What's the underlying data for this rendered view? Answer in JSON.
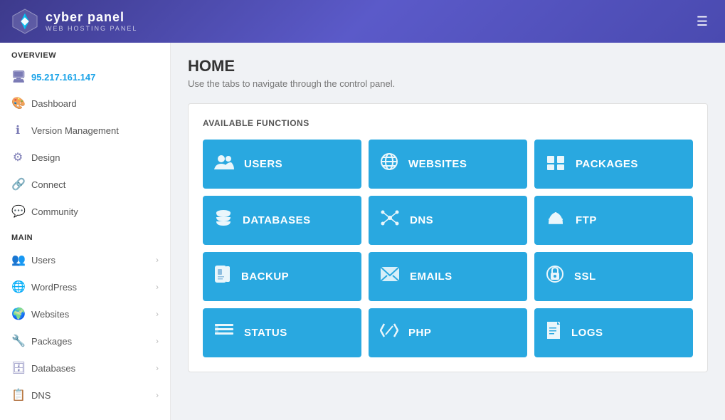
{
  "header": {
    "logo_title": "cyber panel",
    "logo_subtitle": "WEB HOSTING PANEL",
    "toggle_icon": "☰"
  },
  "sidebar": {
    "overview_label": "OVERVIEW",
    "main_label": "MAIN",
    "ip_address": "95.217.161.147",
    "overview_items": [
      {
        "id": "dashboard",
        "label": "Dashboard",
        "icon": "🎨",
        "has_arrow": false
      },
      {
        "id": "version-management",
        "label": "Version Management",
        "icon": "ℹ",
        "has_arrow": false
      },
      {
        "id": "design",
        "label": "Design",
        "icon": "⚙",
        "has_arrow": false
      },
      {
        "id": "connect",
        "label": "Connect",
        "icon": "🔗",
        "has_arrow": false
      },
      {
        "id": "community",
        "label": "Community",
        "icon": "💬",
        "has_arrow": false
      }
    ],
    "main_items": [
      {
        "id": "users",
        "label": "Users",
        "icon": "👥",
        "has_arrow": true
      },
      {
        "id": "wordpress",
        "label": "WordPress",
        "icon": "🌐",
        "has_arrow": true
      },
      {
        "id": "websites",
        "label": "Websites",
        "icon": "🌍",
        "has_arrow": true
      },
      {
        "id": "packages",
        "label": "Packages",
        "icon": "🔧",
        "has_arrow": true
      },
      {
        "id": "databases",
        "label": "Databases",
        "icon": "🗄",
        "has_arrow": true
      },
      {
        "id": "dns",
        "label": "DNS",
        "icon": "📋",
        "has_arrow": true
      }
    ]
  },
  "content": {
    "page_title": "HOME",
    "page_subtitle": "Use the tabs to navigate through the control panel.",
    "available_functions_label": "AVAILABLE FUNCTIONS",
    "functions": [
      {
        "id": "users",
        "label": "USERS",
        "icon": "👥"
      },
      {
        "id": "websites",
        "label": "WEBSITES",
        "icon": "🌐"
      },
      {
        "id": "packages",
        "label": "PACKAGES",
        "icon": "📦"
      },
      {
        "id": "databases",
        "label": "DATABASES",
        "icon": "🗄"
      },
      {
        "id": "dns",
        "label": "DNS",
        "icon": "📡"
      },
      {
        "id": "ftp",
        "label": "FTP",
        "icon": "☁"
      },
      {
        "id": "backup",
        "label": "BACKUP",
        "icon": "📁"
      },
      {
        "id": "emails",
        "label": "EMAILS",
        "icon": "✉"
      },
      {
        "id": "ssl",
        "label": "SSL",
        "icon": "🔒"
      },
      {
        "id": "status",
        "label": "STATUS",
        "icon": "📊"
      },
      {
        "id": "php",
        "label": "PHP",
        "icon": "⚙"
      },
      {
        "id": "logs",
        "label": "LOGS",
        "icon": "📄"
      }
    ]
  }
}
